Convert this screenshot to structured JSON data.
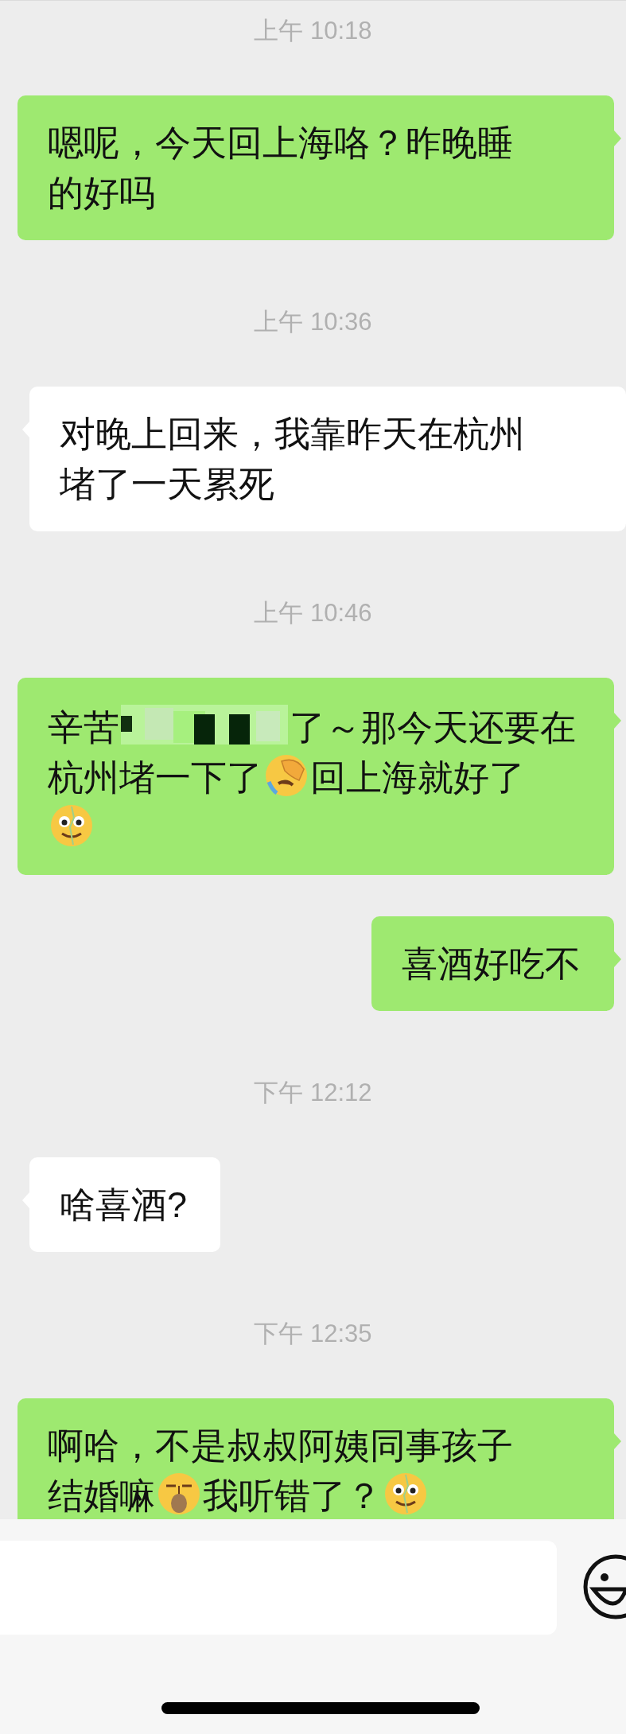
{
  "messages": [
    {
      "kind": "time",
      "text": "上午 10:18"
    },
    {
      "kind": "sent_bubble",
      "lines": [
        [
          {
            "kind": "text",
            "text": "嗯呢，今天回上海咯？昨晚睡"
          }
        ],
        [
          {
            "kind": "text",
            "text": "的好吗"
          }
        ]
      ]
    },
    {
      "kind": "time",
      "text": "上午 10:36"
    },
    {
      "kind": "received_bubble",
      "lines": [
        [
          {
            "kind": "text",
            "text": "对晚上回来，我靠昨天在杭州"
          }
        ],
        [
          {
            "kind": "text",
            "text": "堵了一天累死"
          }
        ]
      ]
    },
    {
      "kind": "time",
      "text": "上午 10:46"
    },
    {
      "kind": "sent_bubble",
      "lines": [
        [
          {
            "kind": "text",
            "text": "辛苦"
          },
          {
            "kind": "mosaic"
          },
          {
            "kind": "text",
            "text": "了～那今天还要在"
          }
        ],
        [
          {
            "kind": "text",
            "text": "杭州堵一下了"
          },
          {
            "kind": "facepalm"
          },
          {
            "kind": "text",
            "text": "回上海就好了"
          }
        ],
        [
          {
            "kind": "dizzy"
          }
        ]
      ]
    },
    {
      "kind": "sent_bubble",
      "lines": [
        [
          {
            "kind": "text",
            "text": "喜酒好吃不"
          }
        ]
      ]
    },
    {
      "kind": "time",
      "text": "下午 12:12"
    },
    {
      "kind": "received_bubble",
      "lines": [
        [
          {
            "kind": "text",
            "text": "啥喜酒?"
          }
        ]
      ]
    },
    {
      "kind": "time",
      "text": "下午 12:35"
    },
    {
      "kind": "sent_bubble",
      "lines": [
        [
          {
            "kind": "text",
            "text": "啊哈，不是叔叔阿姨同事孩子"
          }
        ],
        [
          {
            "kind": "text",
            "text": "结婚嘛"
          },
          {
            "kind": "smug"
          },
          {
            "kind": "text",
            "text": "我听错了？"
          },
          {
            "kind": "dizzy"
          }
        ]
      ]
    }
  ]
}
